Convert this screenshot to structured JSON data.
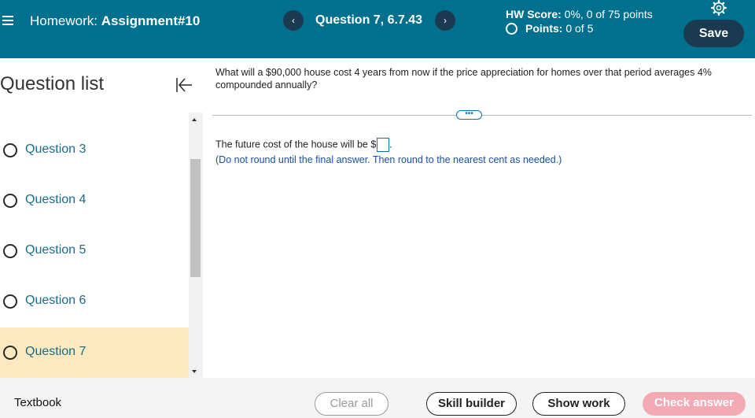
{
  "header": {
    "hw_prefix": "Homework: ",
    "hw_name": "Assignment#10",
    "prev_label": "‹",
    "question_title": "Question 7, 6.7.43",
    "next_label": "›",
    "score_label": "HW Score:",
    "score_value": " 0%, 0 of 75 points",
    "points_label": "Points:",
    "points_value": " 0 of 5",
    "save_label": "Save"
  },
  "sidebar": {
    "title": "Question list",
    "items": [
      {
        "label": "Question 3"
      },
      {
        "label": "Question 4"
      },
      {
        "label": "Question 5"
      },
      {
        "label": "Question 6"
      },
      {
        "label": "Question 7"
      }
    ]
  },
  "main": {
    "question_text": "What will a $90,000 house cost 4 years from now if the price appreciation for homes over that period averages 4% compounded annually?",
    "more_label": "•••",
    "answer_prefix": "The future cost of the house will be $",
    "answer_suffix": ".",
    "hint": "(Do not round until the final answer. Then round to the nearest cent as needed.)"
  },
  "footer": {
    "textbook": "Textbook",
    "clear": "Clear all",
    "skill": "Skill builder",
    "show": "Show work",
    "check": "Check answer"
  },
  "colors": {
    "header_bg": "#00708f",
    "dark_button": "#1c3a4f",
    "active_item_bg": "#fde9bd",
    "link_text": "#1b6b85",
    "check_button": "#f3aab3"
  }
}
